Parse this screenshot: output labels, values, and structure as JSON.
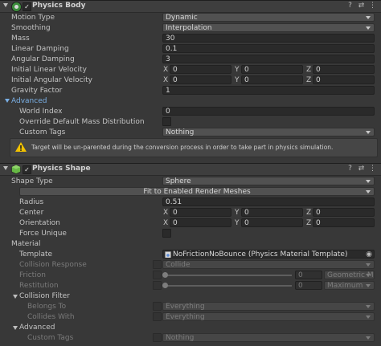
{
  "physics_body": {
    "title": "Physics Body",
    "motion_type": {
      "label": "Motion Type",
      "value": "Dynamic"
    },
    "smoothing": {
      "label": "Smoothing",
      "value": "Interpolation"
    },
    "mass": {
      "label": "Mass",
      "value": "30"
    },
    "linear_damping": {
      "label": "Linear Damping",
      "value": "0.1"
    },
    "angular_damping": {
      "label": "Angular Damping",
      "value": "3"
    },
    "initial_linear_velocity": {
      "label": "Initial Linear Velocity",
      "x": "0",
      "y": "0",
      "z": "0"
    },
    "initial_angular_velocity": {
      "label": "Initial Angular Velocity",
      "x": "0",
      "y": "0",
      "z": "0"
    },
    "gravity_factor": {
      "label": "Gravity Factor",
      "value": "1"
    },
    "advanced": {
      "label": "Advanced",
      "world_index": {
        "label": "World Index",
        "value": "0"
      },
      "override_mass": {
        "label": "Override Default Mass Distribution"
      },
      "custom_tags": {
        "label": "Custom Tags",
        "value": "Nothing"
      }
    },
    "warning": "Target will be un-parented during the conversion process in order to take part in physics simulation."
  },
  "physics_shape": {
    "title": "Physics Shape",
    "shape_type": {
      "label": "Shape Type",
      "value": "Sphere"
    },
    "fit_button": "Fit to Enabled Render Meshes",
    "radius": {
      "label": "Radius",
      "value": "0.51"
    },
    "center": {
      "label": "Center",
      "x": "0",
      "y": "0",
      "z": "0"
    },
    "orientation": {
      "label": "Orientation",
      "x": "0",
      "y": "0",
      "z": "0"
    },
    "force_unique": {
      "label": "Force Unique"
    },
    "material": {
      "label": "Material",
      "template": {
        "label": "Template",
        "value": "NoFrictionNoBounce (Physics Material Template)"
      },
      "collision_response": {
        "label": "Collision Response",
        "value": "Collide"
      },
      "friction": {
        "label": "Friction",
        "value": "0",
        "combine": "Geometric Me"
      },
      "restitution": {
        "label": "Restitution",
        "value": "0",
        "combine": "Maximum"
      },
      "collision_filter": {
        "label": "Collision Filter",
        "belongs_to": {
          "label": "Belongs To",
          "value": "Everything"
        },
        "collides_with": {
          "label": "Collides With",
          "value": "Everything"
        }
      },
      "advanced": {
        "label": "Advanced",
        "custom_tags": {
          "label": "Custom Tags",
          "value": "Nothing"
        }
      }
    }
  },
  "axis_labels": {
    "x": "X",
    "y": "Y",
    "z": "Z"
  },
  "colors": {
    "accent": "#7ab0e6",
    "warning": "#f2c200",
    "background": "#383838"
  }
}
